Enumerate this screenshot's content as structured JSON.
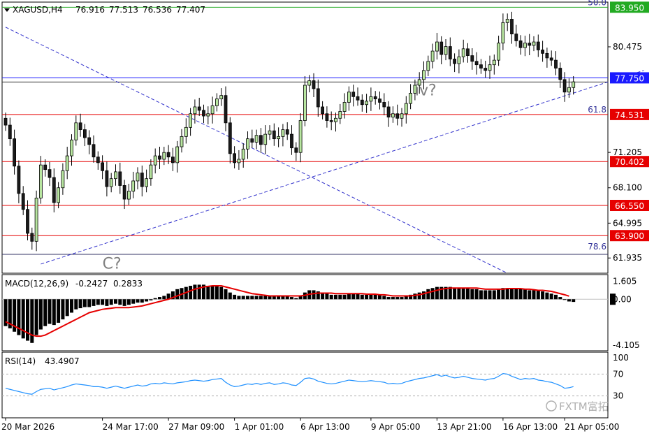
{
  "chart_data": [
    {
      "type": "candlestick",
      "symbol": "XAGUSD,H4",
      "ohlc_header": [
        "76.916",
        "77.513",
        "76.536",
        "77.407"
      ],
      "ylim": [
        60.6,
        84.4
      ],
      "price_ticks": [
        {
          "value": 80.475,
          "label": "80.475"
        },
        {
          "value": 71.205,
          "label": "71.205"
        },
        {
          "value": 68.1,
          "label": "68.100"
        },
        {
          "value": 64.995,
          "label": "64.995"
        },
        {
          "value": 61.935,
          "label": "61.935"
        }
      ],
      "levels": [
        {
          "value": 83.95,
          "label": "83.950",
          "color": "#22aa22"
        },
        {
          "value": 77.75,
          "label": "77.750",
          "color": "#1a1aff"
        },
        {
          "value": 74.531,
          "label": "74.531",
          "color": "#e60000"
        },
        {
          "value": 70.402,
          "label": "70.402",
          "color": "#e60000"
        },
        {
          "value": 66.55,
          "label": "66.550",
          "color": "#e60000"
        },
        {
          "value": 63.9,
          "label": "63.900",
          "color": "#e60000"
        }
      ],
      "fib_labels": [
        {
          "text": "50.0",
          "value": 83.95
        },
        {
          "text": "61.8",
          "value": 74.531
        },
        {
          "text": "78.6",
          "value": 62.5
        }
      ],
      "wave_labels": [
        {
          "text": "iv?",
          "bar": 93,
          "value": 76.2
        },
        {
          "text": "C?",
          "bar": 22,
          "value": 61.0
        }
      ],
      "trendlines": [
        {
          "bar1": 8,
          "v1": 61.4,
          "bar2": 145,
          "v2": 78.4,
          "color": "#3333cc"
        },
        {
          "bar1": 0,
          "v1": 82.2,
          "bar2": 114,
          "v2": 60.6,
          "color": "#3333cc"
        }
      ],
      "closes": [
        73.6,
        72.4,
        70.0,
        67.6,
        66.2,
        64.1,
        63.4,
        67.2,
        70.1,
        69.7,
        69.0,
        66.8,
        68.1,
        69.6,
        70.9,
        72.3,
        73.8,
        73.2,
        72.5,
        71.9,
        70.8,
        70.3,
        69.6,
        68.2,
        68.9,
        69.5,
        68.3,
        67.1,
        67.8,
        68.7,
        69.4,
        68.2,
        68.9,
        70.1,
        70.9,
        70.6,
        71.2,
        70.8,
        70.3,
        71.7,
        72.6,
        73.4,
        74.6,
        75.2,
        74.9,
        74.4,
        74.6,
        75.3,
        75.9,
        76.2,
        73.8,
        71.1,
        70.3,
        70.6,
        71.5,
        72.4,
        72.1,
        72.7,
        71.9,
        72.8,
        73.1,
        72.4,
        72.6,
        73.2,
        72.8,
        71.6,
        71.2,
        74.0,
        77.1,
        77.5,
        76.8,
        75.2,
        74.6,
        74.0,
        73.9,
        74.2,
        74.8,
        75.6,
        76.5,
        76.1,
        75.8,
        75.4,
        75.7,
        76.1,
        75.9,
        75.6,
        75.2,
        74.3,
        74.6,
        74.2,
        74.6,
        75.5,
        76.4,
        77.1,
        77.6,
        78.4,
        79.2,
        80.1,
        80.9,
        79.8,
        80.5,
        79.4,
        79.0,
        79.6,
        80.3,
        79.7,
        79.2,
        78.9,
        78.6,
        78.4,
        78.9,
        79.3,
        80.8,
        82.6,
        82.9,
        81.6,
        81.0,
        80.4,
        80.8,
        80.6,
        80.9,
        80.2,
        79.9,
        79.5,
        79.3,
        78.6,
        77.6,
        76.5,
        76.9,
        77.4
      ],
      "macd_label": "MACD(12,26,9)",
      "macd_values": [
        "-0.2427",
        "0.2833"
      ],
      "macd_ticks": [
        {
          "value": 1.605,
          "label": "1.605"
        },
        {
          "value": 0.0,
          "label": "0.00"
        },
        {
          "value": -4.105,
          "label": "-4.105"
        }
      ],
      "macd_ylim": [
        -4.6,
        2.2
      ],
      "macd_hist": [
        -2.4,
        -2.6,
        -2.9,
        -3.2,
        -3.5,
        -3.7,
        -3.9,
        -3.2,
        -2.7,
        -2.4,
        -2.2,
        -2.3,
        -2.1,
        -1.8,
        -1.5,
        -1.2,
        -0.9,
        -0.8,
        -0.7,
        -0.7,
        -0.6,
        -0.5,
        -0.5,
        -0.6,
        -0.5,
        -0.4,
        -0.5,
        -0.6,
        -0.5,
        -0.4,
        -0.3,
        -0.3,
        -0.2,
        -0.1,
        0.1,
        0.2,
        0.3,
        0.5,
        0.7,
        0.9,
        1.0,
        1.1,
        1.2,
        1.3,
        1.3,
        1.3,
        1.2,
        1.2,
        1.2,
        1.1,
        0.9,
        0.6,
        0.4,
        0.3,
        0.3,
        0.3,
        0.3,
        0.3,
        0.3,
        0.3,
        0.3,
        0.3,
        0.3,
        0.3,
        0.3,
        0.2,
        0.1,
        0.3,
        0.6,
        0.8,
        0.8,
        0.7,
        0.6,
        0.5,
        0.4,
        0.4,
        0.4,
        0.4,
        0.5,
        0.5,
        0.5,
        0.4,
        0.4,
        0.4,
        0.4,
        0.4,
        0.3,
        0.2,
        0.2,
        0.2,
        0.2,
        0.3,
        0.4,
        0.5,
        0.6,
        0.7,
        0.9,
        1.0,
        1.1,
        1.1,
        1.1,
        1.1,
        1.0,
        1.0,
        1.0,
        1.0,
        0.9,
        0.9,
        0.8,
        0.8,
        0.8,
        0.8,
        0.9,
        1.0,
        1.0,
        1.0,
        0.9,
        0.9,
        0.9,
        0.8,
        0.8,
        0.8,
        0.7,
        0.6,
        0.5,
        0.4,
        0.2,
        0.0,
        -0.2,
        -0.24
      ],
      "macd_signal": [
        -2.0,
        -2.2,
        -2.4,
        -2.6,
        -2.8,
        -3.0,
        -3.2,
        -3.3,
        -3.3,
        -3.2,
        -3.0,
        -2.8,
        -2.6,
        -2.4,
        -2.2,
        -2.0,
        -1.8,
        -1.6,
        -1.4,
        -1.2,
        -1.1,
        -1.0,
        -0.9,
        -0.85,
        -0.8,
        -0.75,
        -0.75,
        -0.75,
        -0.75,
        -0.7,
        -0.65,
        -0.6,
        -0.5,
        -0.4,
        -0.3,
        -0.2,
        -0.1,
        0.0,
        0.15,
        0.3,
        0.45,
        0.6,
        0.75,
        0.9,
        1.0,
        1.1,
        1.15,
        1.2,
        1.2,
        1.2,
        1.1,
        1.0,
        0.9,
        0.8,
        0.7,
        0.6,
        0.5,
        0.45,
        0.4,
        0.35,
        0.3,
        0.3,
        0.3,
        0.3,
        0.3,
        0.3,
        0.3,
        0.3,
        0.35,
        0.45,
        0.5,
        0.55,
        0.55,
        0.55,
        0.55,
        0.5,
        0.5,
        0.5,
        0.5,
        0.5,
        0.5,
        0.5,
        0.45,
        0.45,
        0.45,
        0.4,
        0.4,
        0.35,
        0.3,
        0.3,
        0.3,
        0.3,
        0.3,
        0.35,
        0.4,
        0.5,
        0.6,
        0.7,
        0.8,
        0.9,
        0.95,
        1.0,
        1.0,
        1.0,
        1.0,
        1.0,
        1.0,
        1.0,
        0.95,
        0.9,
        0.9,
        0.9,
        0.9,
        0.9,
        0.95,
        0.95,
        0.95,
        0.95,
        0.9,
        0.9,
        0.85,
        0.8,
        0.8,
        0.75,
        0.7,
        0.6,
        0.5,
        0.4,
        0.28
      ],
      "rsi_label": "RSI(14)",
      "rsi_value": "43.4907",
      "rsi_ticks": [
        {
          "value": 100,
          "label": "100"
        },
        {
          "value": 70,
          "label": "70"
        },
        {
          "value": 30,
          "label": "30"
        }
      ],
      "rsi_ylim": [
        0,
        100
      ],
      "rsi": [
        44,
        42,
        40,
        38,
        36,
        34,
        33,
        38,
        42,
        43,
        44,
        41,
        43,
        45,
        47,
        50,
        52,
        51,
        50,
        49,
        47,
        47,
        46,
        44,
        46,
        48,
        46,
        44,
        46,
        48,
        50,
        48,
        49,
        52,
        53,
        52,
        54,
        53,
        52,
        54,
        55,
        56,
        58,
        59,
        58,
        57,
        58,
        60,
        61,
        62,
        55,
        50,
        47,
        48,
        50,
        52,
        51,
        53,
        51,
        53,
        54,
        51,
        52,
        54,
        53,
        50,
        49,
        55,
        62,
        63,
        61,
        57,
        55,
        53,
        52,
        53,
        55,
        57,
        59,
        58,
        57,
        56,
        57,
        58,
        57,
        56,
        55,
        52,
        53,
        52,
        53,
        56,
        58,
        60,
        62,
        63,
        65,
        67,
        69,
        66,
        68,
        65,
        63,
        64,
        66,
        64,
        62,
        61,
        60,
        59,
        61,
        62,
        66,
        71,
        70,
        66,
        63,
        60,
        62,
        61,
        62,
        59,
        58,
        56,
        55,
        52,
        49,
        44,
        45,
        47
      ],
      "xlabels": [
        {
          "text": "20 Mar 2026",
          "bar": 0
        },
        {
          "text": "24 Mar 17:00",
          "bar": 22
        },
        {
          "text": "27 Mar 09:00",
          "bar": 37
        },
        {
          "text": "1 Apr 01:00",
          "bar": 52
        },
        {
          "text": "6 Apr 13:00",
          "bar": 67
        },
        {
          "text": "9 Apr 05:00",
          "bar": 83
        },
        {
          "text": "13 Apr 21:00",
          "bar": 98
        },
        {
          "text": "16 Apr 13:00",
          "bar": 113
        },
        {
          "text": "21 Apr 05:00",
          "bar": 127
        }
      ],
      "colors": {
        "bull_fill": "#b8e6a0",
        "bear_fill": "#1a1a1a",
        "candle_outline": "#000000",
        "macd_signal": "#e60000",
        "rsi_line": "#1e90ff",
        "price_box_red": "#e60000",
        "price_box_green": "#22aa22",
        "price_box_blue": "#1a1aff"
      }
    }
  ],
  "watermark": "FXTM富拓"
}
